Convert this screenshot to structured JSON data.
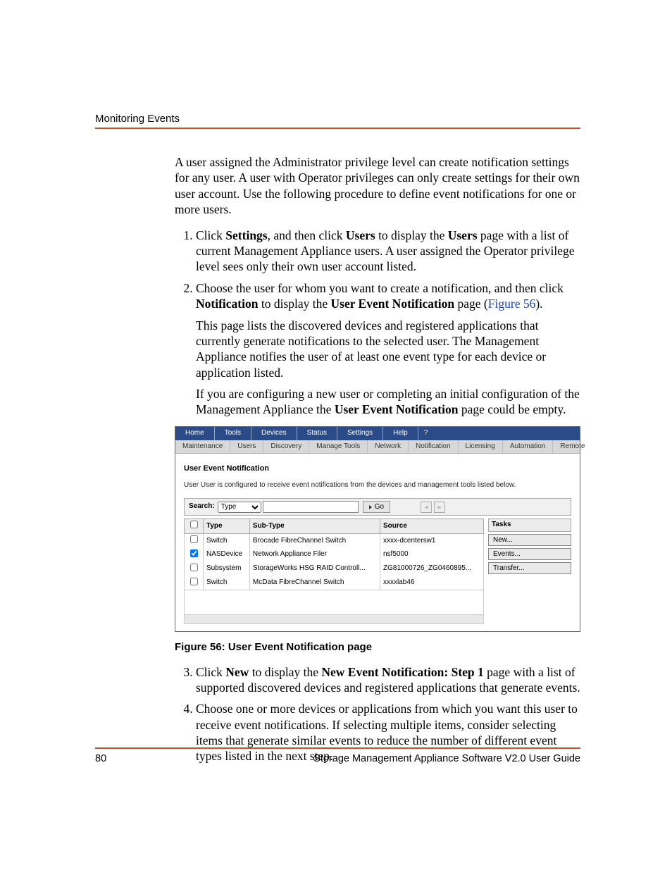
{
  "header": {
    "running_head": "Monitoring Events"
  },
  "body": {
    "intro": "A user assigned the Administrator privilege level can create notification settings for any user. A user with Operator privileges can only create settings for their own user account. Use the following procedure to define event notifications for one or more users.",
    "step1_a": "Click ",
    "step1_b": "Settings",
    "step1_c": ", and then click ",
    "step1_d": "Users",
    "step1_e": " to display the ",
    "step1_f": "Users",
    "step1_g": " page with a list of current Management Appliance users. A user assigned the Operator privilege level sees only their own user account listed.",
    "step2_a": "Choose the user for whom you want to create a notification, and then click ",
    "step2_b": "Notification",
    "step2_c": " to display the ",
    "step2_d": "User Event Notification",
    "step2_e": " page (",
    "step2_link": "Figure 56",
    "step2_f": ").",
    "step2_p1": "This page lists the discovered devices and registered applications that currently generate notifications to the selected user. The Management Appliance notifies the user of at least one event type for each device or application listed.",
    "step2_p2a": "If you are configuring a new user or completing an initial configuration of the Management Appliance the ",
    "step2_p2b": "User Event Notification",
    "step2_p2c": " page could be empty.",
    "figure_caption": "Figure 56:  User Event Notification page",
    "step3_a": "Click ",
    "step3_b": "New",
    "step3_c": " to display the ",
    "step3_d": "New Event Notification: Step 1",
    "step3_e": " page with a list of supported discovered devices and registered applications that generate events.",
    "step4": "Choose one or more devices or applications from which you want this user to receive event notifications. If selecting multiple items, consider selecting items that generate similar events to reduce the number of different event types listed in the next step."
  },
  "figure": {
    "menu": [
      "Home",
      "Tools",
      "Devices",
      "Status",
      "Settings",
      "Help",
      "?"
    ],
    "submenu": [
      "Maintenance",
      "Users",
      "Discovery",
      "Manage Tools",
      "Network",
      "Notification",
      "Licensing",
      "Automation",
      "Remote"
    ],
    "pane_title": "User Event Notification",
    "pane_desc": "User User is configured to receive event notifications from the devices and management tools listed below.",
    "search_label": "Search:",
    "search_selected": "Type",
    "go_label": "Go",
    "columns": {
      "type": "Type",
      "subtype": "Sub-Type",
      "source": "Source"
    },
    "rows": [
      {
        "checked": false,
        "type": "Switch",
        "subtype": "Brocade FibreChannel Switch",
        "source": "xxxx-dcentersw1"
      },
      {
        "checked": true,
        "type": "NASDevice",
        "subtype": "Network Appliance Filer",
        "source": "nsf5000"
      },
      {
        "checked": false,
        "type": "Subsystem",
        "subtype": "StorageWorks HSG RAID Controll...",
        "source": "ZG81000726_ZG0460895..."
      },
      {
        "checked": false,
        "type": "Switch",
        "subtype": "McData FibreChannel Switch",
        "source": "xxxxlab46"
      }
    ],
    "tasks_header": "Tasks",
    "tasks": [
      "New...",
      "Events...",
      "Transfer..."
    ]
  },
  "footer": {
    "page_number": "80",
    "doc_title": "Storage Management Appliance Software V2.0 User Guide"
  }
}
